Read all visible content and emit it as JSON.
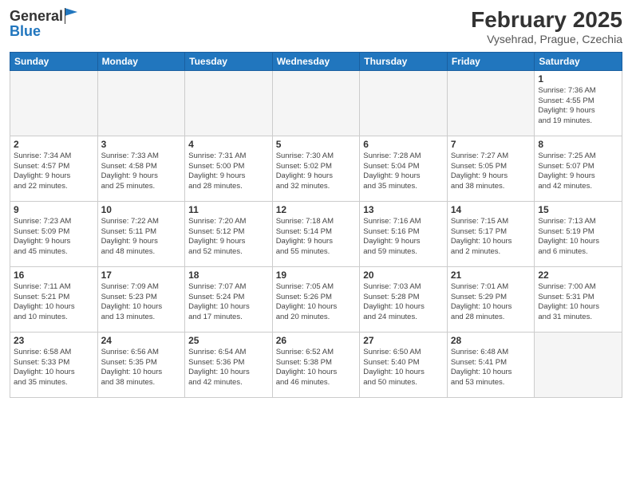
{
  "header": {
    "logo_line1": "General",
    "logo_line2": "Blue",
    "month_year": "February 2025",
    "location": "Vysehrad, Prague, Czechia"
  },
  "weekdays": [
    "Sunday",
    "Monday",
    "Tuesday",
    "Wednesday",
    "Thursday",
    "Friday",
    "Saturday"
  ],
  "weeks": [
    [
      {
        "day": "",
        "info": ""
      },
      {
        "day": "",
        "info": ""
      },
      {
        "day": "",
        "info": ""
      },
      {
        "day": "",
        "info": ""
      },
      {
        "day": "",
        "info": ""
      },
      {
        "day": "",
        "info": ""
      },
      {
        "day": "1",
        "info": "Sunrise: 7:36 AM\nSunset: 4:55 PM\nDaylight: 9 hours\nand 19 minutes."
      }
    ],
    [
      {
        "day": "2",
        "info": "Sunrise: 7:34 AM\nSunset: 4:57 PM\nDaylight: 9 hours\nand 22 minutes."
      },
      {
        "day": "3",
        "info": "Sunrise: 7:33 AM\nSunset: 4:58 PM\nDaylight: 9 hours\nand 25 minutes."
      },
      {
        "day": "4",
        "info": "Sunrise: 7:31 AM\nSunset: 5:00 PM\nDaylight: 9 hours\nand 28 minutes."
      },
      {
        "day": "5",
        "info": "Sunrise: 7:30 AM\nSunset: 5:02 PM\nDaylight: 9 hours\nand 32 minutes."
      },
      {
        "day": "6",
        "info": "Sunrise: 7:28 AM\nSunset: 5:04 PM\nDaylight: 9 hours\nand 35 minutes."
      },
      {
        "day": "7",
        "info": "Sunrise: 7:27 AM\nSunset: 5:05 PM\nDaylight: 9 hours\nand 38 minutes."
      },
      {
        "day": "8",
        "info": "Sunrise: 7:25 AM\nSunset: 5:07 PM\nDaylight: 9 hours\nand 42 minutes."
      }
    ],
    [
      {
        "day": "9",
        "info": "Sunrise: 7:23 AM\nSunset: 5:09 PM\nDaylight: 9 hours\nand 45 minutes."
      },
      {
        "day": "10",
        "info": "Sunrise: 7:22 AM\nSunset: 5:11 PM\nDaylight: 9 hours\nand 48 minutes."
      },
      {
        "day": "11",
        "info": "Sunrise: 7:20 AM\nSunset: 5:12 PM\nDaylight: 9 hours\nand 52 minutes."
      },
      {
        "day": "12",
        "info": "Sunrise: 7:18 AM\nSunset: 5:14 PM\nDaylight: 9 hours\nand 55 minutes."
      },
      {
        "day": "13",
        "info": "Sunrise: 7:16 AM\nSunset: 5:16 PM\nDaylight: 9 hours\nand 59 minutes."
      },
      {
        "day": "14",
        "info": "Sunrise: 7:15 AM\nSunset: 5:17 PM\nDaylight: 10 hours\nand 2 minutes."
      },
      {
        "day": "15",
        "info": "Sunrise: 7:13 AM\nSunset: 5:19 PM\nDaylight: 10 hours\nand 6 minutes."
      }
    ],
    [
      {
        "day": "16",
        "info": "Sunrise: 7:11 AM\nSunset: 5:21 PM\nDaylight: 10 hours\nand 10 minutes."
      },
      {
        "day": "17",
        "info": "Sunrise: 7:09 AM\nSunset: 5:23 PM\nDaylight: 10 hours\nand 13 minutes."
      },
      {
        "day": "18",
        "info": "Sunrise: 7:07 AM\nSunset: 5:24 PM\nDaylight: 10 hours\nand 17 minutes."
      },
      {
        "day": "19",
        "info": "Sunrise: 7:05 AM\nSunset: 5:26 PM\nDaylight: 10 hours\nand 20 minutes."
      },
      {
        "day": "20",
        "info": "Sunrise: 7:03 AM\nSunset: 5:28 PM\nDaylight: 10 hours\nand 24 minutes."
      },
      {
        "day": "21",
        "info": "Sunrise: 7:01 AM\nSunset: 5:29 PM\nDaylight: 10 hours\nand 28 minutes."
      },
      {
        "day": "22",
        "info": "Sunrise: 7:00 AM\nSunset: 5:31 PM\nDaylight: 10 hours\nand 31 minutes."
      }
    ],
    [
      {
        "day": "23",
        "info": "Sunrise: 6:58 AM\nSunset: 5:33 PM\nDaylight: 10 hours\nand 35 minutes."
      },
      {
        "day": "24",
        "info": "Sunrise: 6:56 AM\nSunset: 5:35 PM\nDaylight: 10 hours\nand 38 minutes."
      },
      {
        "day": "25",
        "info": "Sunrise: 6:54 AM\nSunset: 5:36 PM\nDaylight: 10 hours\nand 42 minutes."
      },
      {
        "day": "26",
        "info": "Sunrise: 6:52 AM\nSunset: 5:38 PM\nDaylight: 10 hours\nand 46 minutes."
      },
      {
        "day": "27",
        "info": "Sunrise: 6:50 AM\nSunset: 5:40 PM\nDaylight: 10 hours\nand 50 minutes."
      },
      {
        "day": "28",
        "info": "Sunrise: 6:48 AM\nSunset: 5:41 PM\nDaylight: 10 hours\nand 53 minutes."
      },
      {
        "day": "",
        "info": ""
      }
    ]
  ]
}
